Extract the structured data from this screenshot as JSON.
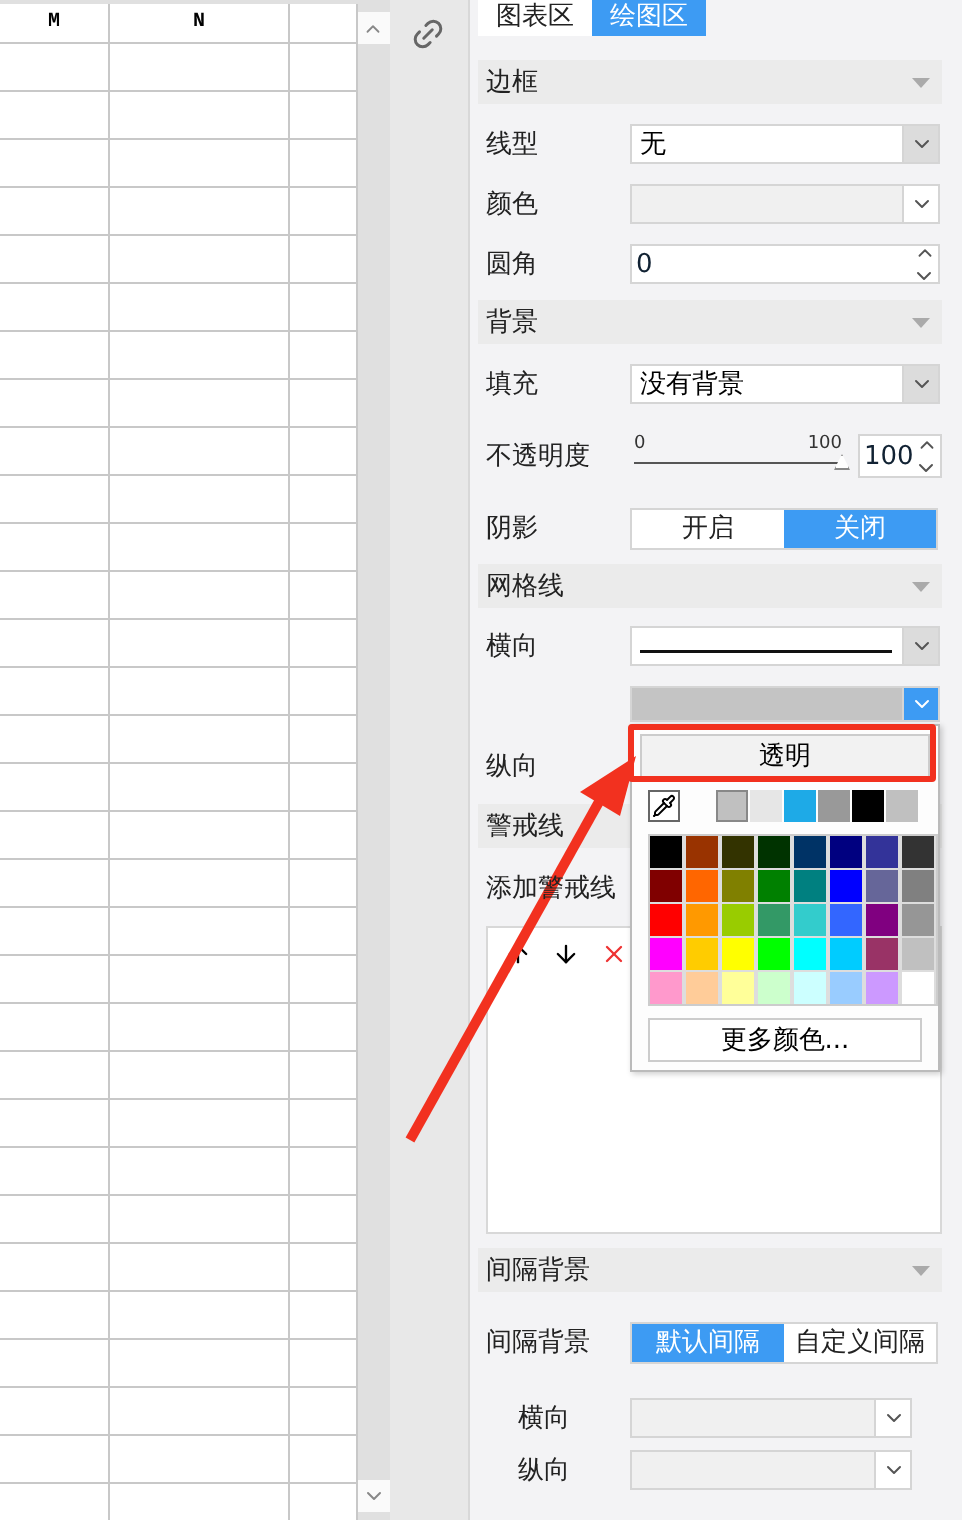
{
  "table": {
    "columns": [
      "M",
      "N"
    ]
  },
  "tabs": [
    {
      "label": "图表区",
      "selected": false
    },
    {
      "label": "绘图区",
      "selected": true
    }
  ],
  "sections": [
    {
      "title": "边框",
      "rows": [
        {
          "kind": "select",
          "label": "线型",
          "value": "无"
        },
        {
          "kind": "color",
          "label": "颜色"
        },
        {
          "kind": "number",
          "label": "圆角",
          "value": "0"
        }
      ]
    },
    {
      "title": "背景",
      "rows": [
        {
          "kind": "select",
          "label": "填充",
          "value": "没有背景"
        },
        {
          "kind": "slider",
          "label": "不透明度",
          "min": "0",
          "max": "100",
          "level": 1,
          "value": "100"
        },
        {
          "kind": "toggle",
          "label": "阴影",
          "options": [
            {
              "label": "开启",
              "selected": false
            },
            {
              "label": "关闭",
              "selected": true
            }
          ]
        }
      ]
    },
    {
      "title": "网格线",
      "rows": [
        {
          "kind": "line",
          "label": "横向"
        },
        {
          "kind": "color_open"
        },
        {
          "kind": "label",
          "label": "纵向"
        }
      ]
    },
    {
      "title": "警戒线",
      "rows": [
        {
          "kind": "list",
          "label": "添加警戒线"
        }
      ]
    },
    {
      "title": "间隔背景",
      "rows": [
        {
          "kind": "toggle",
          "label": "间隔背景",
          "options": [
            {
              "label": "默认间隔",
              "selected": true
            },
            {
              "label": "自定义间隔",
              "selected": false
            }
          ]
        },
        {
          "kind": "sub_color",
          "label": "横向"
        },
        {
          "kind": "sub_color",
          "label": "纵向"
        }
      ]
    }
  ],
  "color_picker": {
    "transparent_label": "透明",
    "more_label": "更多颜色...",
    "recent": [
      {
        "color": "#c0c0c0",
        "selected": true
      },
      {
        "color": "#e6e6e6",
        "selected": false
      },
      {
        "color": "#1eaae7",
        "selected": false
      },
      {
        "color": "#999999",
        "selected": false
      },
      {
        "color": "#000000",
        "selected": false
      },
      {
        "color": "#c0c0c0",
        "selected": false
      }
    ],
    "palette": [
      {
        "color": "#000000"
      },
      {
        "color": "#993300"
      },
      {
        "color": "#333300"
      },
      {
        "color": "#003300"
      },
      {
        "color": "#003366"
      },
      {
        "color": "#000080"
      },
      {
        "color": "#333399"
      },
      {
        "color": "#333333"
      },
      {
        "color": "#800000"
      },
      {
        "color": "#ff6600"
      },
      {
        "color": "#808000"
      },
      {
        "color": "#008000"
      },
      {
        "color": "#008080"
      },
      {
        "color": "#0000ff"
      },
      {
        "color": "#666699"
      },
      {
        "color": "#808080"
      },
      {
        "color": "#ff0000"
      },
      {
        "color": "#ff9900"
      },
      {
        "color": "#99cc00"
      },
      {
        "color": "#339966"
      },
      {
        "color": "#33cccc"
      },
      {
        "color": "#3366ff"
      },
      {
        "color": "#800080"
      },
      {
        "color": "#969696"
      },
      {
        "color": "#ff00ff"
      },
      {
        "color": "#ffcc00"
      },
      {
        "color": "#ffff00"
      },
      {
        "color": "#00ff00"
      },
      {
        "color": "#00ffff"
      },
      {
        "color": "#00ccff"
      },
      {
        "color": "#993366"
      },
      {
        "color": "#c0c0c0"
      },
      {
        "color": "#ff99cc"
      },
      {
        "color": "#ffcc99"
      },
      {
        "color": "#ffff99"
      },
      {
        "color": "#ccffcc"
      },
      {
        "color": "#ccffff"
      },
      {
        "color": "#99ccff"
      },
      {
        "color": "#cc99ff"
      },
      {
        "color": "#ffffff"
      }
    ]
  }
}
